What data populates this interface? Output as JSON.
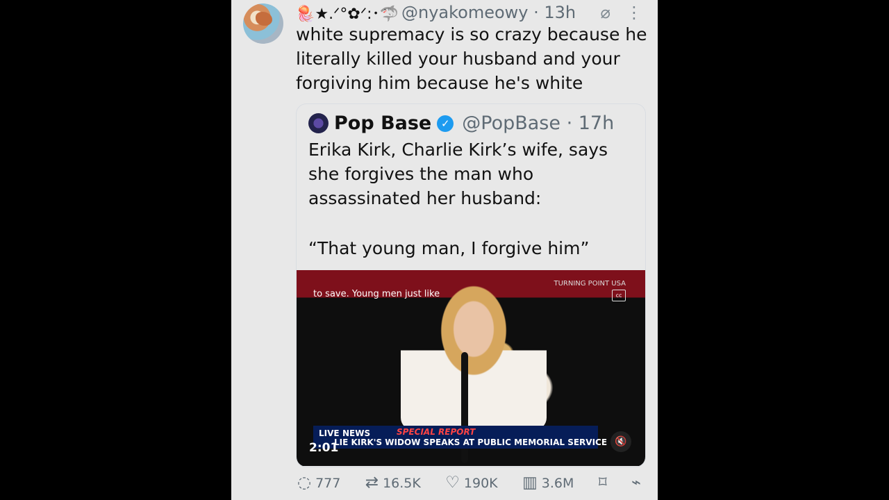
{
  "post": {
    "display_name": "🪼★.ᐟ°✿ᐟ:･🦈",
    "handle": "@nyakomeowy",
    "time": "13h",
    "text": "white supremacy is so crazy because he literally killed your husband and your forgiving him because he's white"
  },
  "quoted_post": {
    "name": "Pop Base",
    "handle": "@PopBase",
    "time": "17h",
    "text": "Erika Kirk, Charlie Kirk’s wife, says she forgives the man who assassinated her husband:",
    "quote": "“That young man, I forgive him”"
  },
  "video": {
    "caption": "to save. Young men just like",
    "brand": "TURNING POINT USA",
    "cc": "cc",
    "live": "LIVE",
    "news": "NEWS",
    "special": "SPECIAL REPORT",
    "headline": "LIE KIRK'S WIDOW SPEAKS AT PUBLIC MEMORIAL SERVICE",
    "timer": "2:01"
  },
  "actions": {
    "replies": "777",
    "reposts": "16.5K",
    "likes": "190K",
    "views": "3.6M"
  },
  "icons": {
    "avatar": "avatar-image",
    "reply": "reply-icon",
    "repost": "repost-icon",
    "like": "heart-icon",
    "views": "views-icon",
    "bookmark": "bookmark-icon",
    "share": "share-icon",
    "more": "more-icon",
    "grok": "grok-icon"
  },
  "colors": {
    "background": "#000000",
    "panel": "#e8e8e8",
    "text": "#111111",
    "muted": "#5f6b75",
    "verified": "#1d9bf0"
  }
}
